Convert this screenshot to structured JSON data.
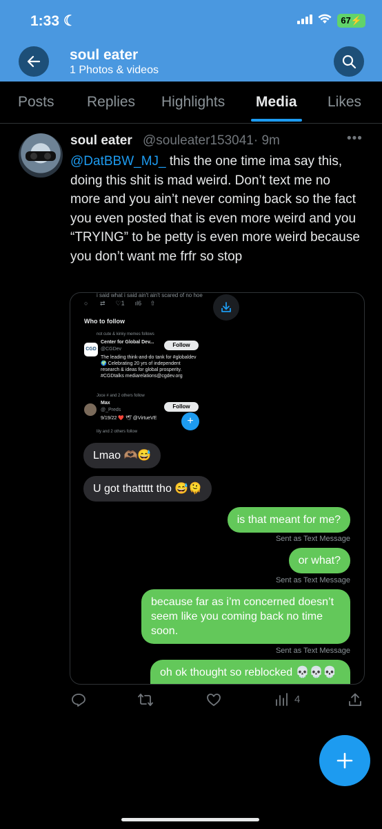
{
  "status": {
    "time": "1:33",
    "battery": "67"
  },
  "header": {
    "title": "soul eater",
    "subtitle": "1 Photos & videos"
  },
  "tabs": [
    "Posts",
    "Replies",
    "Highlights",
    "Media",
    "Likes"
  ],
  "tweet": {
    "name": "soul eater",
    "handle": "@souleater153041",
    "time": "· 9m",
    "mention": "@DatBBW_MJ_",
    "text": " this the one time ima say this, doing this shit is mad weird. Don’t text me no more and you ain’t never coming back so the fact you even posted that is even more weird and you “TRYING” to be petty is even more weird because you don’t want me frfr so stop"
  },
  "media": {
    "top_text": "i said what i said ain't ain't scared of no hoe",
    "top_counts": [
      "1",
      "6"
    ],
    "who_to_follow": "Who to follow",
    "ctx1": "not cute & kinky memes follows",
    "org_name": "Center for Global Dev...",
    "org_handle": "@CGDev",
    "org_bio": "The leading think-and-do tank for #globaldev 🌍 Celebrating 20 yrs of independent research & ideas for global prosperity. #CGDtalks mediarelations@cgdev.org",
    "follow_label": "Follow",
    "ctx2": "Joce # and 2 others follow",
    "user2_name": "Max",
    "user2_handle": "@_Preds",
    "user2_bio": "9/19/22 ❤️ 🕊 @VirtueVE",
    "ctx3": "lily and 2 others follow",
    "messages": [
      {
        "side": "in",
        "text": "Lmao 🫶🏽😅"
      },
      {
        "side": "in",
        "text": "U got thattttt tho 😅🫠"
      },
      {
        "side": "out",
        "text": "is that meant for me?",
        "note": "Sent as Text Message"
      },
      {
        "side": "out",
        "text": "or what?",
        "note": "Sent as Text Message"
      },
      {
        "side": "out",
        "text": "because far as i’m concerned doesn’t seem like you coming back no time soon.",
        "note": "Sent as Text Message"
      },
      {
        "side": "out",
        "text": "oh ok thought so reblocked 💀💀💀"
      }
    ]
  },
  "actions": {
    "views": "4"
  },
  "icons": {
    "back": "back-arrow-icon",
    "search": "search-icon",
    "reply": "reply-icon",
    "retweet": "retweet-icon",
    "like": "heart-icon",
    "views": "views-icon",
    "share": "share-icon",
    "compose": "plus-icon"
  },
  "colors": {
    "header": "#4a98e0",
    "accent": "#1d9bf0",
    "imessage_green": "#63c85a"
  }
}
